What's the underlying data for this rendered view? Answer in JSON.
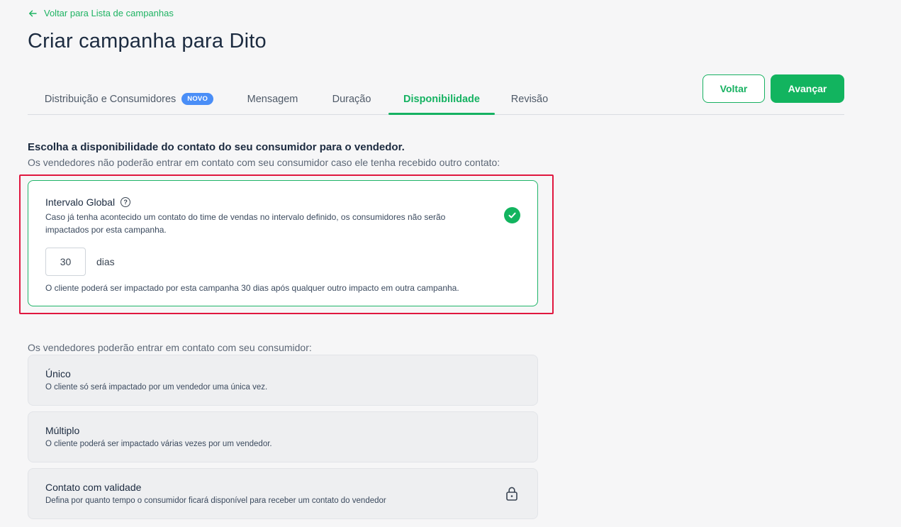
{
  "nav": {
    "back_link": "Voltar para Lista de campanhas"
  },
  "page_title": "Criar campanha para Dito",
  "tabs": [
    {
      "label": "Distribuição e Consumidores",
      "badge": "NOVO"
    },
    {
      "label": "Mensagem"
    },
    {
      "label": "Duração"
    },
    {
      "label": "Disponibilidade",
      "active": true
    },
    {
      "label": "Revisão"
    }
  ],
  "buttons": {
    "back": "Voltar",
    "next": "Avançar"
  },
  "availability": {
    "title": "Escolha a disponibilidade do contato do seu consumidor para o vendedor.",
    "subtitle": "Os vendedores não poderão entrar em contato com seu consumidor caso ele tenha recebido outro contato:",
    "global_interval": {
      "title": "Intervalo Global",
      "help_icon": "?",
      "description": "Caso já tenha acontecido um contato do time de vendas no intervalo definido, os consumidores não serão impactados por esta campanha.",
      "days_value": "30",
      "days_unit": "dias",
      "note": "O cliente poderá ser impactado por esta campanha 30 dias após qualquer outro impacto em outra campanha.",
      "selected": true
    }
  },
  "contact_options": {
    "subtitle": "Os vendedores poderão entrar em contato com seu consumidor:",
    "items": [
      {
        "title": "Único",
        "description": "O cliente só será impactado por um vendedor uma única vez."
      },
      {
        "title": "Múltiplo",
        "description": "O cliente poderá ser impactado várias vezes por um vendedor."
      },
      {
        "title": "Contato com validade",
        "description": "Defina por quanto tempo o consumidor ficará disponível para receber um contato do vendedor",
        "icon": "lock-icon"
      }
    ]
  },
  "colors": {
    "accent": "#12b45f",
    "badge": "#4a8ef7",
    "highlight": "#e0173f"
  }
}
